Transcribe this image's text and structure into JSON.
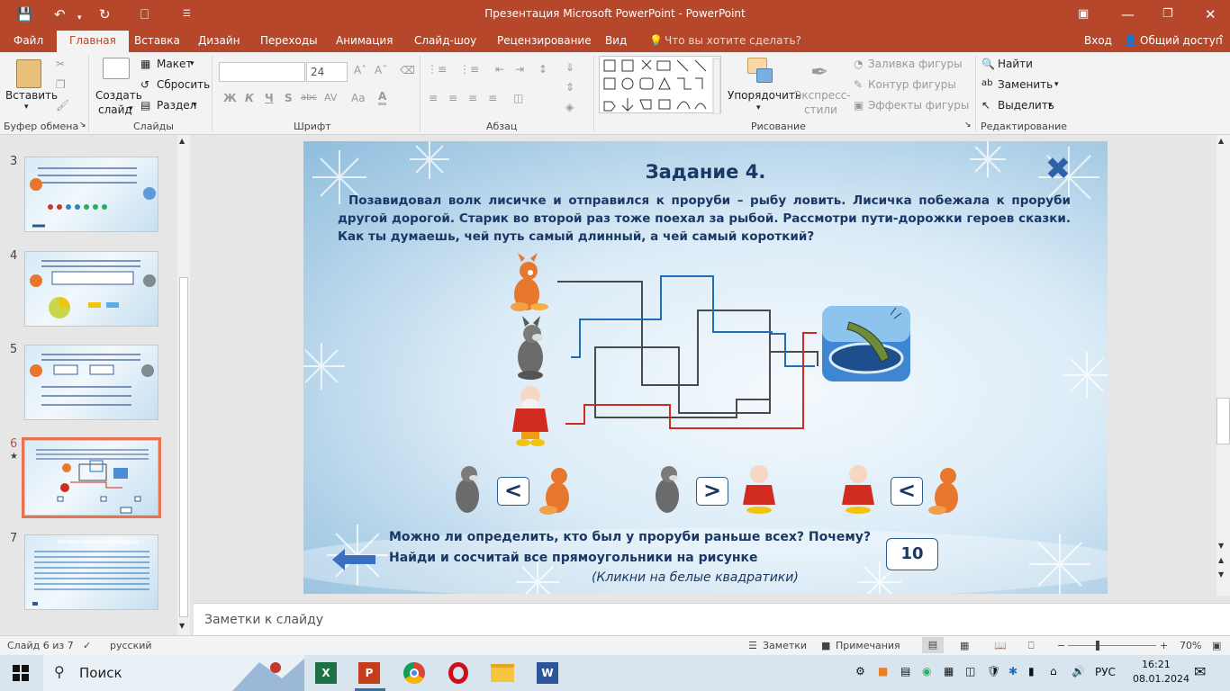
{
  "window": {
    "title": "Презентация Microsoft PowerPoint - PowerPoint",
    "search_hint": "Что вы хотите сделать?",
    "login": "Вход",
    "share": "Общий доступ"
  },
  "tabs": [
    "Файл",
    "Главная",
    "Вставка",
    "Дизайн",
    "Переходы",
    "Анимация",
    "Слайд-шоу",
    "Рецензирование",
    "Вид"
  ],
  "ribbon": {
    "paste": "Вставить",
    "clipboard_group": "Буфер обмена",
    "new_slide_1": "Создать",
    "new_slide_2": "слайд",
    "layout": "Макет",
    "reset": "Сбросить",
    "section": "Раздел",
    "slides_group": "Слайды",
    "font_size": "24",
    "font_group": "Шрифт",
    "font_btns": [
      "Ж",
      "К",
      "Ч",
      "S",
      "abc",
      "AV",
      "Aa"
    ],
    "paragraph_group": "Абзац",
    "arrange": "Упорядочить",
    "quick_styles_1": "Экспресс-",
    "quick_styles_2": "стили",
    "fill": "Заливка фигуры",
    "outline": "Контур фигуры",
    "effects": "Эффекты фигуры",
    "drawing_group": "Рисование",
    "find": "Найти",
    "replace": "Заменить",
    "select": "Выделить",
    "editing_group": "Редактирование"
  },
  "thumbnails": [
    {
      "num": "3"
    },
    {
      "num": "4"
    },
    {
      "num": "5"
    },
    {
      "num": "6"
    },
    {
      "num": "7",
      "title": "Использованные ресурсы"
    }
  ],
  "slide": {
    "title": "Задание  4.",
    "paragraph": "Позавидовал волк лисичке и отправился к проруби – рыбу ловить. Лисичка побежала к проруби другой дорогой. Старик во второй раз тоже поехал за рыбой. Рассмотри пути-дорожки героев сказки. Как ты думаешь, чей путь самый длинный, а чей самый короткий?",
    "comparisons": [
      "<",
      ">",
      "<"
    ],
    "question_1": "Можно ли определить, кто был у проруби раньше всех? Почему?",
    "question_2": "Найди и сосчитай все прямоугольники на рисунке",
    "hint": "(Кликни на белые квадратики)",
    "answer": "10"
  },
  "notes_placeholder": "Заметки к слайду",
  "status": {
    "slide_info": "Слайд 6 из 7",
    "language": "русский",
    "notes": "Заметки",
    "comments": "Примечания",
    "zoom": "70%"
  },
  "taskbar": {
    "search": "Поиск",
    "lang": "РУС",
    "time": "16:21",
    "date": "08.01.2024"
  },
  "colors": {
    "accent": "#b7472a",
    "path_fox": "#4a4a4a",
    "path_wolf": "#1f6fb8",
    "path_old_man": "#d12a1f",
    "slide_text": "#1a3766"
  }
}
